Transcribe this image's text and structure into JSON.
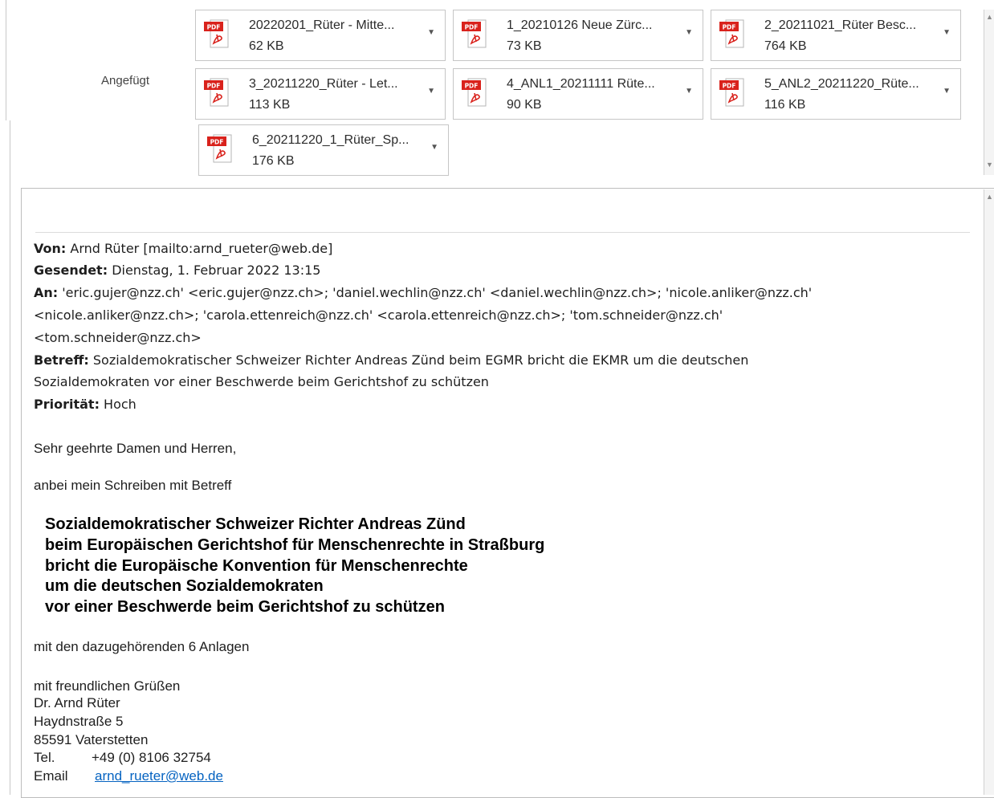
{
  "header": {
    "attached_label": "Angefügt"
  },
  "attachments": [
    {
      "name": "20220201_Rüter - Mitte...",
      "size": "62 KB"
    },
    {
      "name": "1_20210126 Neue Zürc...",
      "size": "73 KB"
    },
    {
      "name": "2_20211021_Rüter Besc...",
      "size": "764 KB"
    },
    {
      "name": "3_20211220_Rüter - Let...",
      "size": "113 KB"
    },
    {
      "name": "4_ANL1_20211111 Rüte...",
      "size": "90 KB"
    },
    {
      "name": "5_ANL2_20211220_Rüte...",
      "size": "116 KB"
    },
    {
      "name": "6_20211220_1_Rüter_Sp...",
      "size": "176 KB"
    }
  ],
  "pdf_badge": "PDF",
  "message": {
    "from_label": "Von:",
    "from_value": " Arnd Rüter [mailto:arnd_rueter@web.de]",
    "sent_label": "Gesendet:",
    "sent_value": " Dienstag, 1. Februar 2022 13:15",
    "to_label": "An:",
    "to_line1": " 'eric.gujer@nzz.ch' <eric.gujer@nzz.ch>; 'daniel.wechlin@nzz.ch' <daniel.wechlin@nzz.ch>; 'nicole.anliker@nzz.ch'",
    "to_line2": "<nicole.anliker@nzz.ch>; 'carola.ettenreich@nzz.ch' <carola.ettenreich@nzz.ch>; 'tom.schneider@nzz.ch'",
    "to_line3": "<tom.schneider@nzz.ch>",
    "subject_label": "Betreff:",
    "subject_line1": " Sozialdemokratischer Schweizer Richter Andreas Zünd beim EGMR bricht die EKMR um die deutschen",
    "subject_line2": "Sozialdemokraten vor einer Beschwerde beim Gerichtshof zu schützen",
    "priority_label": "Priorität:",
    "priority_value": " Hoch",
    "greeting": "Sehr geehrte Damen und Herren,",
    "intro": "anbei mein Schreiben mit Betreff",
    "bold_subject": [
      "Sozialdemokratischer Schweizer Richter Andreas Zünd",
      "beim Europäischen Gerichtshof für Menschenrechte in Straßburg",
      "bricht die Europäische Konvention für Menschenrechte",
      "um die deutschen Sozialdemokraten",
      "vor einer Beschwerde beim Gerichtshof zu schützen"
    ],
    "attachments_note": "mit den dazugehörenden 6 Anlagen",
    "signature": {
      "closing": "mit freundlichen Grüßen",
      "name": "Dr. Arnd Rüter",
      "street": "Haydnstraße 5",
      "city": "85591 Vaterstetten",
      "tel_label": "Tel.",
      "tel_value": "+49 (0) 8106 32754",
      "email_label": "Email",
      "email_value": "arnd_rueter@web.de"
    }
  }
}
